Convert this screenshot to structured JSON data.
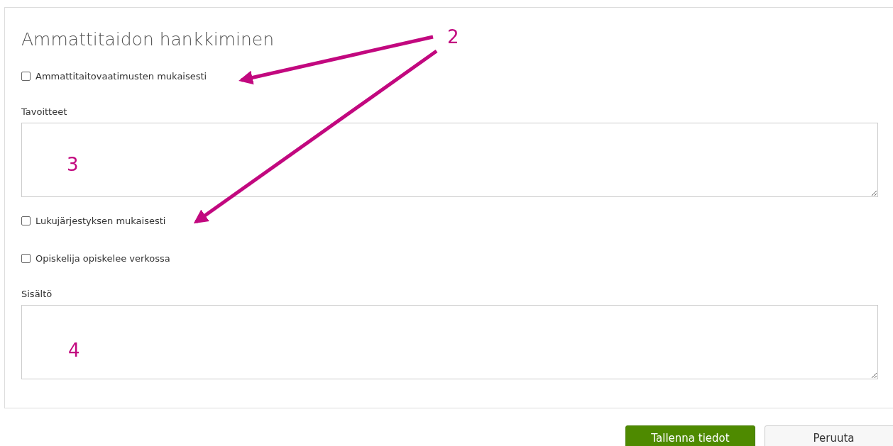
{
  "panel": {
    "title": "Ammattitaidon hankkiminen"
  },
  "fields": [
    {
      "kind": "checkbox",
      "label": "Ammattitaitovaatimusten mukaisesti",
      "checked": false
    },
    {
      "kind": "textarea",
      "label": "Tavoitteet"
    },
    {
      "kind": "checkbox",
      "label": "Lukujärjestyksen mukaisesti",
      "checked": false
    },
    {
      "kind": "checkbox",
      "label": "Opiskelija opiskelee verkossa",
      "checked": false
    },
    {
      "kind": "textarea",
      "label": "Sisältö"
    }
  ],
  "buttons": [
    {
      "kind": "primary",
      "label": "Tallenna tiedot"
    },
    {
      "kind": "secondary",
      "label": "Peruuta"
    }
  ],
  "annotations": [
    {
      "label": "2"
    },
    {
      "label": "3"
    },
    {
      "label": "4"
    }
  ]
}
